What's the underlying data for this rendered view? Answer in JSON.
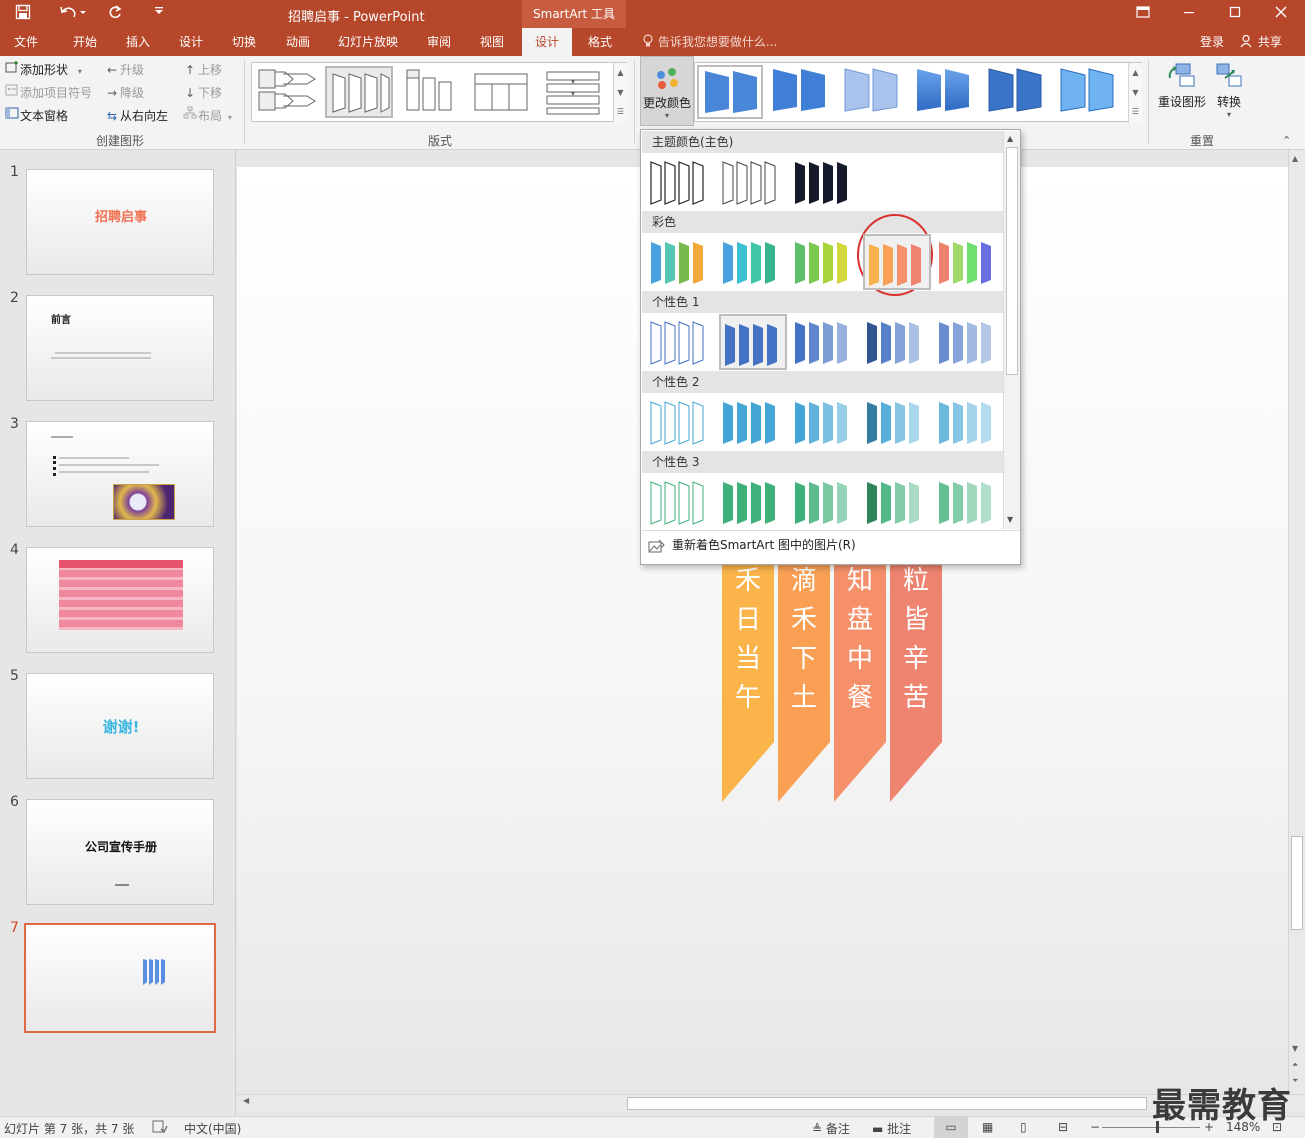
{
  "titlebar": {
    "title": "招聘启事 - PowerPoint",
    "contextual": "SmartArt 工具",
    "icons": [
      "save-icon",
      "undo-icon",
      "redo-icon",
      "customize-icon"
    ],
    "window_buttons": [
      "ribbon-display-icon",
      "minimize-icon",
      "maximize-icon",
      "close-icon"
    ]
  },
  "tabs": [
    {
      "label": "文件"
    },
    {
      "label": "开始"
    },
    {
      "label": "插入"
    },
    {
      "label": "设计"
    },
    {
      "label": "切换"
    },
    {
      "label": "动画"
    },
    {
      "label": "幻灯片放映"
    },
    {
      "label": "审阅"
    },
    {
      "label": "视图"
    },
    {
      "label": "设计"
    },
    {
      "label": "格式"
    }
  ],
  "tell_me": "告诉我您想要做什么...",
  "login": "登录",
  "share": "共享",
  "ribbon": {
    "create_group": {
      "items": [
        {
          "label": "添加形状",
          "icon": "add-shape-icon"
        },
        {
          "label": "添加项目符号",
          "icon": "add-bullet-icon"
        },
        {
          "label": "文本窗格",
          "icon": "text-pane-icon"
        },
        {
          "label": "升级",
          "icon": "arrow-left-icon"
        },
        {
          "label": "降级",
          "icon": "arrow-right-icon"
        },
        {
          "label": "从右向左",
          "icon": "right-to-left-icon"
        },
        {
          "label": "上移",
          "icon": "arrow-up-icon"
        },
        {
          "label": "下移",
          "icon": "arrow-down-icon"
        },
        {
          "label": "布局",
          "icon": "layout-icon"
        }
      ],
      "label": "创建图形"
    },
    "layout_label": "版式",
    "change_color": "更改颜色",
    "reset_group": {
      "reset": "重设图形",
      "convert": "转换",
      "label": "重置"
    }
  },
  "slides": [
    {
      "num": "1",
      "title": "招聘启事"
    },
    {
      "num": "2",
      "title": "前言"
    },
    {
      "num": "3"
    },
    {
      "num": "4"
    },
    {
      "num": "5",
      "title": "谢谢!"
    },
    {
      "num": "6",
      "title": "公司宣传手册"
    },
    {
      "num": "7"
    }
  ],
  "banners": [
    {
      "text": "禾日当午",
      "color": "#fbb44a"
    },
    {
      "text": "滴禾下土",
      "color": "#f9a054"
    },
    {
      "text": "知盘中餐",
      "color": "#f5906a"
    },
    {
      "text": "粒皆辛苦",
      "color": "#ee8470"
    }
  ],
  "dropdown": {
    "sections": [
      {
        "label": "主题颜色(主色)"
      },
      {
        "label": "彩色"
      },
      {
        "label": "个性色 1"
      },
      {
        "label": "个性色 2"
      },
      {
        "label": "个性色 3"
      }
    ],
    "footer": "重新着色SmartArt 图中的图片(R)",
    "colors": {
      "colorful": [
        [
          "#4aa3df",
          "#56c6b4",
          "#79b84e",
          "#f3a93a",
          "#ec6a5a"
        ],
        [
          "#4aa3df",
          "#3cc1d3",
          "#40c5a9",
          "#38b58f",
          "#2ea47a"
        ],
        [
          "#5bbf6b",
          "#7bc94e",
          "#a8d43c",
          "#d2d83c",
          "#f5c041"
        ],
        [
          "#f9b04e",
          "#f9a054",
          "#f5906a",
          "#ee8470",
          "#e57565"
        ],
        [
          "#ee8470",
          "#9fd96a",
          "#6fe070",
          "#6a6ee0",
          "#e85c7a"
        ]
      ],
      "accent1": "#4472c4",
      "accent2": "#45a6d6",
      "accent3": "#3fb07a"
    }
  },
  "status": {
    "slide_info": "幻灯片 第 7 张，共 7 张",
    "language": "中文(中国)",
    "notes": "备注",
    "comments": "批注",
    "zoom": "148%"
  },
  "watermark": "最需教育"
}
